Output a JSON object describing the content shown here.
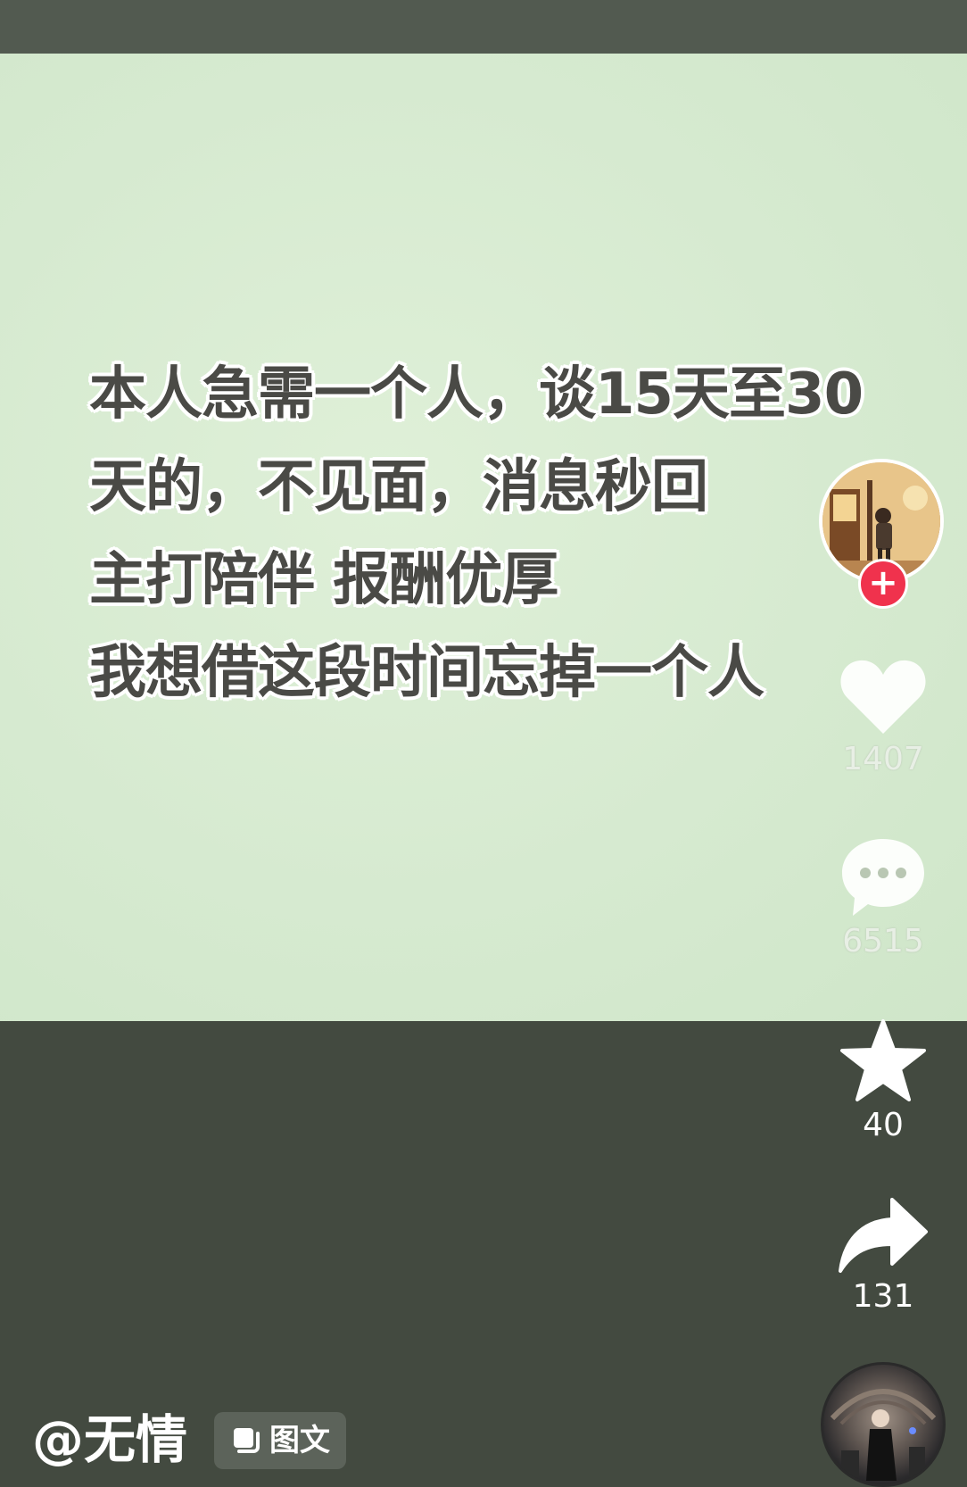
{
  "post": {
    "lines": [
      "本人急需一个人，谈15天至30",
      "天的，不见面，消息秒回",
      "主打陪伴 报酬优厚",
      "我想借这段时间忘掉一个人"
    ]
  },
  "actions": {
    "like": {
      "icon": "heart-icon",
      "count": "1407"
    },
    "comment": {
      "icon": "comment-icon",
      "count": "6515"
    },
    "favorite": {
      "icon": "star-icon",
      "count": "40"
    },
    "share": {
      "icon": "share-icon",
      "count": "131"
    }
  },
  "author": {
    "handle": "@无情",
    "post_type": "图文"
  },
  "colors": {
    "background": "#434a40",
    "image_bg": "#d6ead0",
    "follow_accent": "#f0324d"
  }
}
